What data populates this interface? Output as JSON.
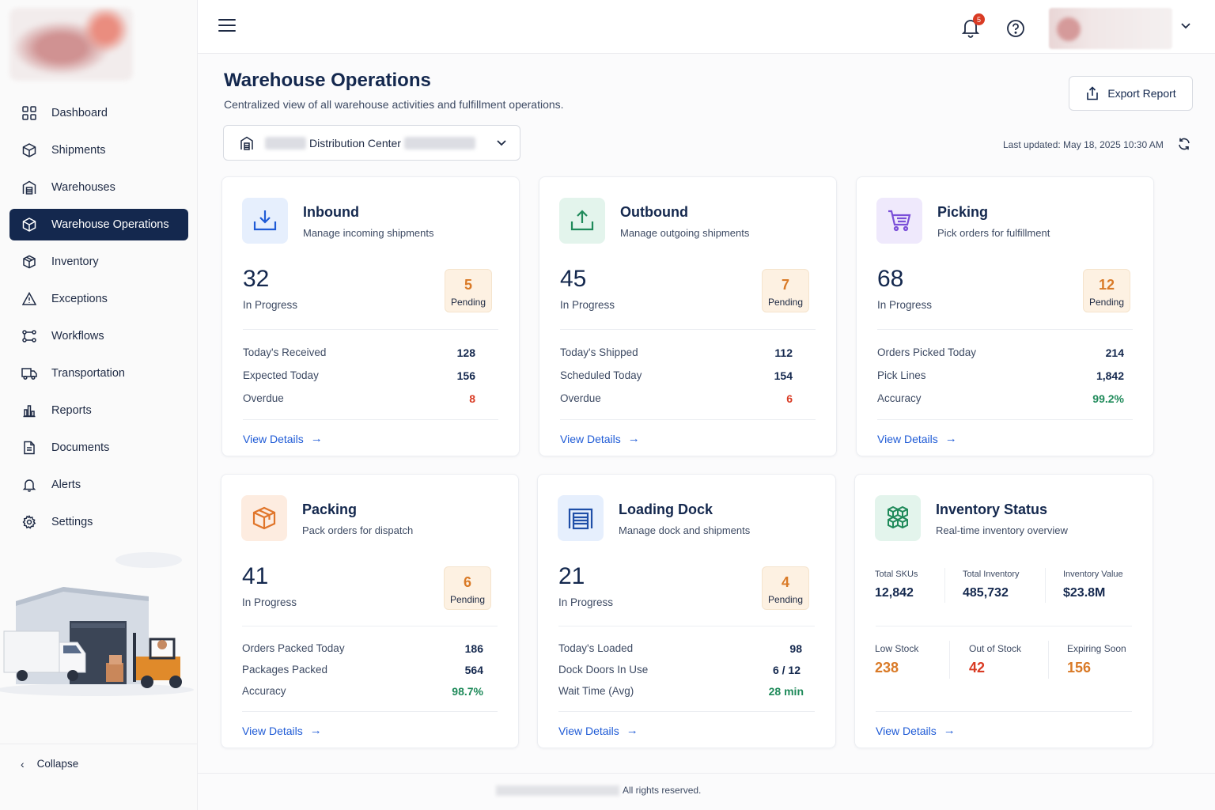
{
  "sidebar": {
    "items": [
      {
        "label": "Dashboard",
        "icon": "grid-icon"
      },
      {
        "label": "Shipments",
        "icon": "box-icon"
      },
      {
        "label": "Warehouses",
        "icon": "warehouse-icon"
      },
      {
        "label": "Warehouse Operations",
        "icon": "box-icon",
        "active": true
      },
      {
        "label": "Inventory",
        "icon": "package-icon"
      },
      {
        "label": "Exceptions",
        "icon": "warning-icon"
      },
      {
        "label": "Workflows",
        "icon": "workflow-icon"
      },
      {
        "label": "Transportation",
        "icon": "truck-icon"
      },
      {
        "label": "Reports",
        "icon": "bar-chart-icon"
      },
      {
        "label": "Documents",
        "icon": "document-icon"
      },
      {
        "label": "Alerts",
        "icon": "bell-icon"
      },
      {
        "label": "Settings",
        "icon": "gear-icon"
      }
    ],
    "collapse_label": "Collapse"
  },
  "topbar": {
    "notification_count": "5"
  },
  "header": {
    "title": "Warehouse Operations",
    "subtitle": "Centralized view of all warehouse activities and fulfillment operations.",
    "export_label": "Export Report",
    "warehouse_select": "Distribution Center",
    "last_updated": "Last updated: May 18, 2025 10:30 AM"
  },
  "cards": {
    "inbound": {
      "title": "Inbound",
      "subtitle": "Manage incoming shipments",
      "in_progress": "32",
      "in_progress_label": "In Progress",
      "pending": "5",
      "pending_label": "Pending",
      "rows": [
        {
          "label": "Today's Received",
          "value": "128"
        },
        {
          "label": "Expected Today",
          "value": "156"
        },
        {
          "label": "Overdue",
          "value": "8"
        }
      ],
      "link": "View Details"
    },
    "outbound": {
      "title": "Outbound",
      "subtitle": "Manage outgoing shipments",
      "in_progress": "45",
      "in_progress_label": "In Progress",
      "pending": "7",
      "pending_label": "Pending",
      "rows": [
        {
          "label": "Today's Shipped",
          "value": "112"
        },
        {
          "label": "Scheduled Today",
          "value": "154"
        },
        {
          "label": "Overdue",
          "value": "6"
        }
      ],
      "link": "View Details"
    },
    "picking": {
      "title": "Picking",
      "subtitle": "Pick orders for fulfillment",
      "in_progress": "68",
      "in_progress_label": "In Progress",
      "pending": "12",
      "pending_label": "Pending",
      "rows": [
        {
          "label": "Orders Picked Today",
          "value": "214"
        },
        {
          "label": "Pick Lines",
          "value": "1,842"
        },
        {
          "label": "Accuracy",
          "value": "99.2%"
        }
      ],
      "link": "View Details"
    },
    "packing": {
      "title": "Packing",
      "subtitle": "Pack orders for dispatch",
      "in_progress": "41",
      "in_progress_label": "In Progress",
      "pending": "6",
      "pending_label": "Pending",
      "rows": [
        {
          "label": "Orders Packed Today",
          "value": "186"
        },
        {
          "label": "Packages Packed",
          "value": "564"
        },
        {
          "label": "Accuracy",
          "value": "98.7%"
        }
      ],
      "link": "View Details"
    },
    "dock": {
      "title": "Loading Dock",
      "subtitle": "Manage dock and shipments",
      "in_progress": "21",
      "in_progress_label": "In Progress",
      "pending": "4",
      "pending_label": "Pending",
      "rows": [
        {
          "label": "Today's Loaded",
          "value": "98"
        },
        {
          "label": "Dock Doors In Use",
          "value": "6 / 12"
        },
        {
          "label": "Wait Time (Avg)",
          "value": "28 min"
        }
      ],
      "link": "View Details"
    },
    "inventory": {
      "title": "Inventory Status",
      "subtitle": "Real-time inventory overview",
      "stats": [
        {
          "label": "Total SKUs",
          "value": "12,842"
        },
        {
          "label": "Total Inventory",
          "value": "485,732"
        },
        {
          "label": "Inventory Value",
          "value": "$23.8M"
        }
      ],
      "alerts": [
        {
          "label": "Low Stock",
          "value": "238"
        },
        {
          "label": "Out of Stock",
          "value": "42"
        },
        {
          "label": "Expiring Soon",
          "value": "156"
        }
      ],
      "link": "View Details"
    }
  },
  "footer": {
    "text": "All rights reserved."
  },
  "colors": {
    "primary": "#14284e",
    "link": "#1f5bd6",
    "pending": "#d97a27",
    "danger": "#d93b24",
    "success": "#1f8a5a"
  }
}
